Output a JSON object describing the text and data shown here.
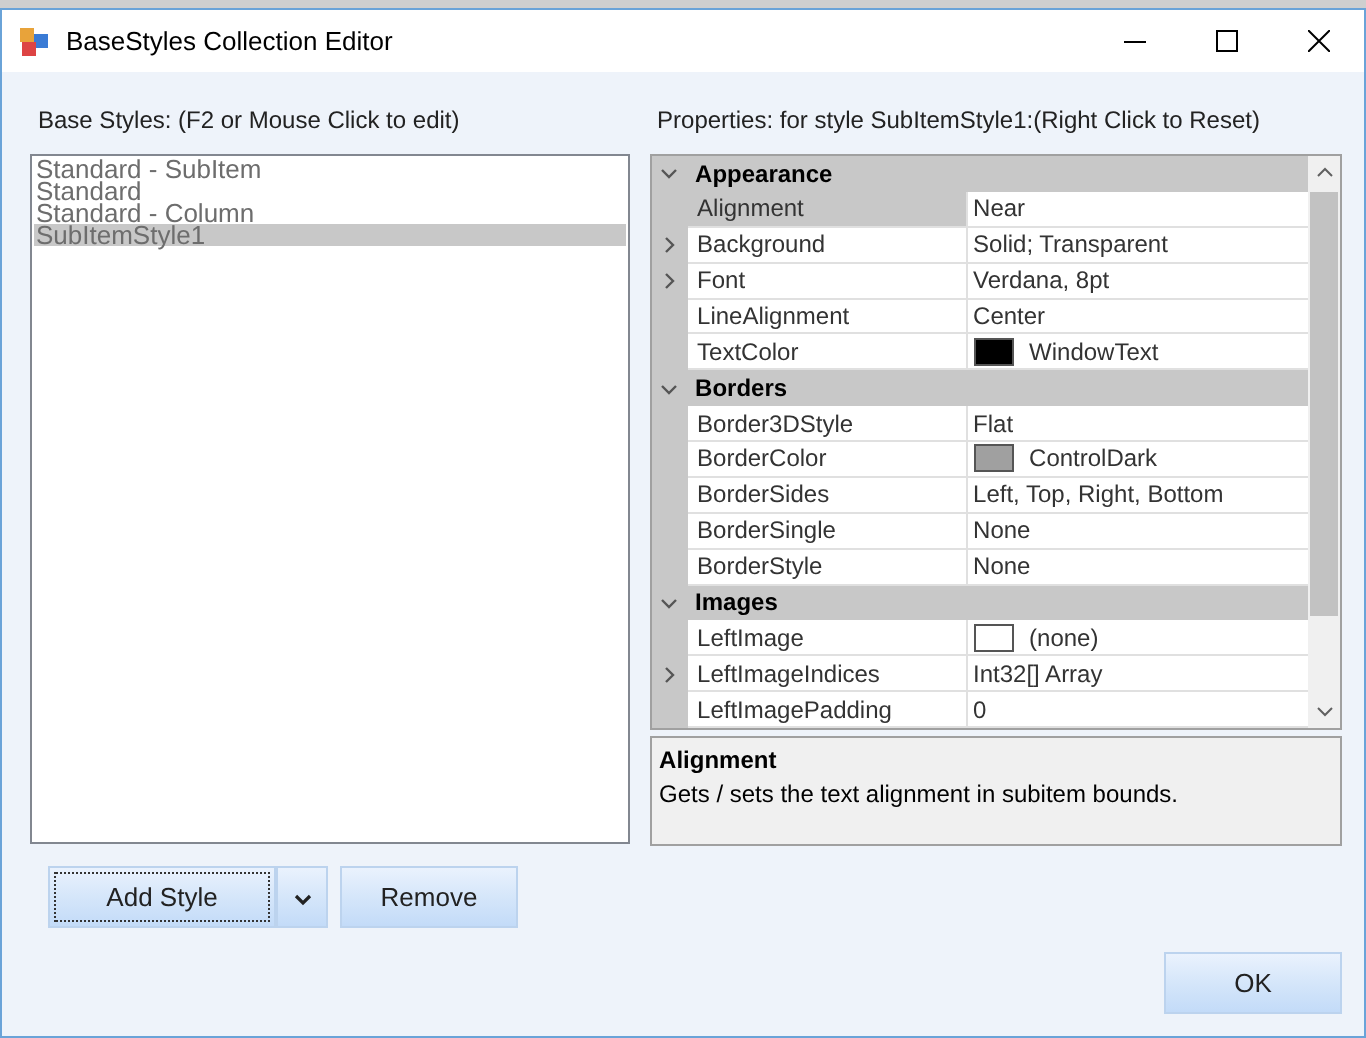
{
  "window": {
    "title": "BaseStyles Collection Editor"
  },
  "styles_panel": {
    "label": "Base Styles: (F2 or Mouse Click to edit)",
    "items": [
      {
        "text": "Standard - SubItem",
        "selected": false
      },
      {
        "text": "Standard",
        "selected": false
      },
      {
        "text": "Standard - Column",
        "selected": false
      },
      {
        "text": "SubItemStyle1",
        "selected": true
      }
    ]
  },
  "properties_panel": {
    "label": "Properties: for style SubItemStyle1:(Right Click to Reset)",
    "rows": [
      {
        "kind": "category",
        "name": "Appearance",
        "expanded": true
      },
      {
        "kind": "property",
        "name": "Alignment",
        "value": "Near",
        "expandable": false,
        "selected": true
      },
      {
        "kind": "property",
        "name": "Background",
        "value": "Solid; Transparent",
        "expandable": true,
        "selected": false
      },
      {
        "kind": "property",
        "name": "Font",
        "value": "Verdana, 8pt",
        "expandable": true,
        "selected": false
      },
      {
        "kind": "property",
        "name": "LineAlignment",
        "value": "Center",
        "expandable": false,
        "selected": false
      },
      {
        "kind": "property",
        "name": "TextColor",
        "value": "WindowText",
        "expandable": false,
        "selected": false,
        "color": "#000000"
      },
      {
        "kind": "category",
        "name": "Borders",
        "expanded": true
      },
      {
        "kind": "property",
        "name": "Border3DStyle",
        "value": "Flat",
        "expandable": false,
        "selected": false
      },
      {
        "kind": "property",
        "name": "BorderColor",
        "value": "ControlDark",
        "expandable": false,
        "selected": false,
        "color": "#a0a0a0"
      },
      {
        "kind": "property",
        "name": "BorderSides",
        "value": "Left, Top, Right, Bottom",
        "expandable": false,
        "selected": false
      },
      {
        "kind": "property",
        "name": "BorderSingle",
        "value": "None",
        "expandable": false,
        "selected": false
      },
      {
        "kind": "property",
        "name": "BorderStyle",
        "value": "None",
        "expandable": false,
        "selected": false
      },
      {
        "kind": "category",
        "name": "Images",
        "expanded": true
      },
      {
        "kind": "property",
        "name": "LeftImage",
        "value": "(none)",
        "expandable": false,
        "selected": false,
        "color": "#ffffff"
      },
      {
        "kind": "property",
        "name": "LeftImageIndices",
        "value": "Int32[] Array",
        "expandable": true,
        "selected": false
      },
      {
        "kind": "property",
        "name": "LeftImagePadding",
        "value": "0",
        "expandable": false,
        "selected": false
      }
    ],
    "description": {
      "title": "Alignment",
      "text": "Gets / sets the text alignment in subitem bounds."
    }
  },
  "buttons": {
    "add": "Add Style",
    "remove": "Remove",
    "ok": "OK"
  }
}
